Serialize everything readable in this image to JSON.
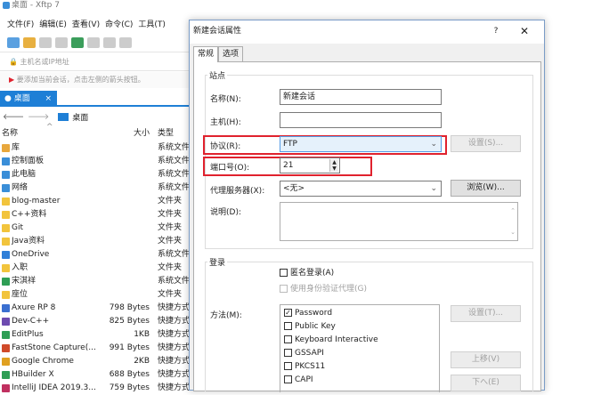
{
  "window": {
    "title": "桌面 - Xftp 7"
  },
  "menu": [
    "文件(F)",
    "编辑(E)",
    "查看(V)",
    "命令(C)",
    "工具(T)"
  ],
  "address_placeholder": "主机名或IP地址",
  "hint": "要添加当前会话，点击左侧的箭头按钮。",
  "tab": {
    "label": "桌面",
    "close": "×"
  },
  "path": {
    "label": "桌面"
  },
  "columns": {
    "name": "名称",
    "size": "大小",
    "type": "类型"
  },
  "files": [
    {
      "name": "库",
      "size": "",
      "type": "系统文件",
      "color": "#e8a73c"
    },
    {
      "name": "控制面板",
      "size": "",
      "type": "系统文件",
      "color": "#3a8ed8"
    },
    {
      "name": "此电脑",
      "size": "",
      "type": "系统文件",
      "color": "#3a8ed8"
    },
    {
      "name": "网络",
      "size": "",
      "type": "系统文件",
      "color": "#3a8ed8"
    },
    {
      "name": "blog-master",
      "size": "",
      "type": "文件夹",
      "color": "#f2c43c"
    },
    {
      "name": "C++资料",
      "size": "",
      "type": "文件夹",
      "color": "#f2c43c"
    },
    {
      "name": "Git",
      "size": "",
      "type": "文件夹",
      "color": "#f2c43c"
    },
    {
      "name": "Java资料",
      "size": "",
      "type": "文件夹",
      "color": "#f2c43c"
    },
    {
      "name": "OneDrive",
      "size": "",
      "type": "系统文件",
      "color": "#2f7fd8"
    },
    {
      "name": "入职",
      "size": "",
      "type": "文件夹",
      "color": "#f2c43c"
    },
    {
      "name": "宋淇祥",
      "size": "",
      "type": "系统文件",
      "color": "#2e9e55"
    },
    {
      "name": "座位",
      "size": "",
      "type": "文件夹",
      "color": "#f2c43c"
    },
    {
      "name": "Axure RP 8",
      "size": "798 Bytes",
      "type": "快捷方式",
      "color": "#3a6fd0"
    },
    {
      "name": "Dev-C++",
      "size": "825 Bytes",
      "type": "快捷方式",
      "color": "#6d4bb0"
    },
    {
      "name": "EditPlus",
      "size": "1KB",
      "type": "快捷方式",
      "color": "#2e9e55"
    },
    {
      "name": "FastStone Capture(...",
      "size": "991 Bytes",
      "type": "快捷方式",
      "color": "#d04a2a"
    },
    {
      "name": "Google Chrome",
      "size": "2KB",
      "type": "快捷方式",
      "color": "#e0a020"
    },
    {
      "name": "HBuilder X",
      "size": "688 Bytes",
      "type": "快捷方式",
      "color": "#2e9e55"
    },
    {
      "name": "IntelliJ IDEA 2019.3...",
      "size": "759 Bytes",
      "type": "快捷方式",
      "color": "#c03060"
    }
  ],
  "dialog": {
    "title": "新建会话属性",
    "help": "?",
    "close": "✕",
    "tabs": [
      "常规",
      "选项"
    ],
    "site": {
      "group_label": "站点",
      "name_label": "名称(N):",
      "name_value": "新建会话",
      "host_label": "主机(H):",
      "host_value": "",
      "protocol_label": "协议(R):",
      "protocol_value": "FTP",
      "settings_btn": "设置(S)...",
      "port_label": "端口号(O):",
      "port_value": "21",
      "proxy_label": "代理服务器(X):",
      "proxy_value": "<无>",
      "browse_btn": "浏览(W)...",
      "desc_label": "说明(D):"
    },
    "login": {
      "group_label": "登录",
      "anon_label": "匿名登录(A)",
      "agent_label": "使用身份验证代理(G)",
      "method_label": "方法(M):",
      "methods": [
        {
          "label": "Password",
          "checked": true
        },
        {
          "label": "Public Key",
          "checked": false
        },
        {
          "label": "Keyboard Interactive",
          "checked": false
        },
        {
          "label": "GSSAPI",
          "checked": false
        },
        {
          "label": "PKCS11",
          "checked": false
        },
        {
          "label": "CAPI",
          "checked": false
        }
      ],
      "settings_btn": "设置(T)...",
      "up_btn": "上移(V)",
      "down_btn": "下へ(E)"
    }
  },
  "colors": {
    "accent": "#1e7fd6",
    "highlight": "#e0222e"
  }
}
